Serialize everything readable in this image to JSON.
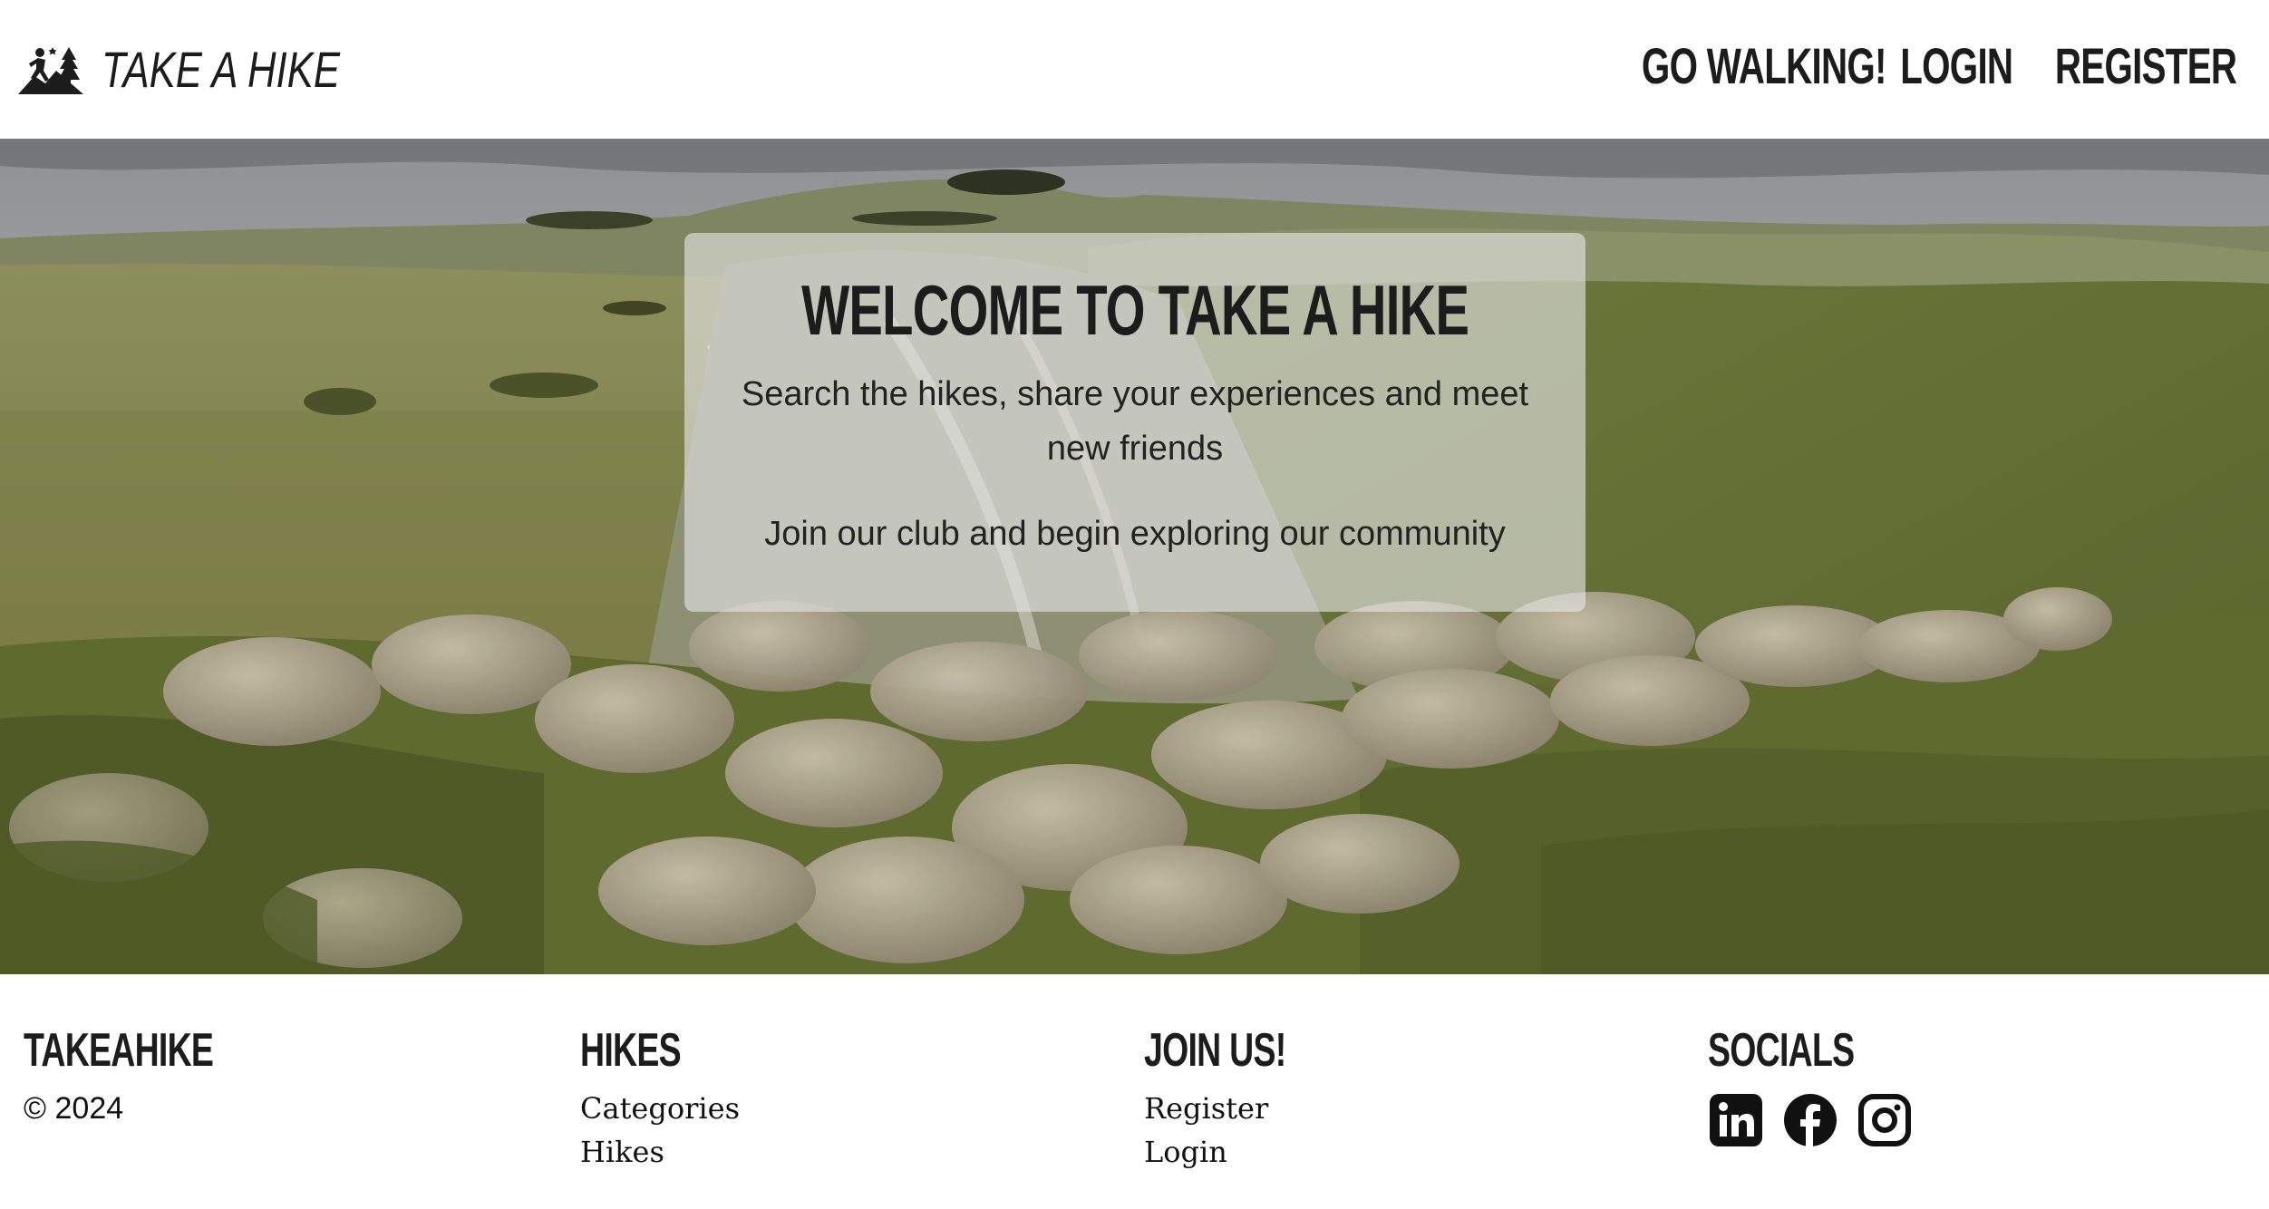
{
  "header": {
    "brand": "TAKE A HIKE",
    "nav": [
      {
        "label": "GO WALKING!"
      },
      {
        "label": "LOGIN"
      },
      {
        "label": "REGISTER"
      }
    ]
  },
  "hero": {
    "title": "WELCOME TO TAKE A HIKE",
    "subtitle": "Search the hikes, share your experiences and meet new friends",
    "join": "Join our club and begin exploring our community"
  },
  "footer": {
    "col1": {
      "heading": "TAKEAHIKE",
      "copyright": "© 2024"
    },
    "col2": {
      "heading": "HIKES",
      "links": [
        "Categories",
        "Hikes"
      ]
    },
    "col3": {
      "heading": "JOIN US!",
      "links": [
        "Register",
        "Login"
      ]
    },
    "col4": {
      "heading": "SOCIALS",
      "icons": [
        "linkedin-icon",
        "facebook-icon",
        "instagram-icon"
      ]
    }
  }
}
